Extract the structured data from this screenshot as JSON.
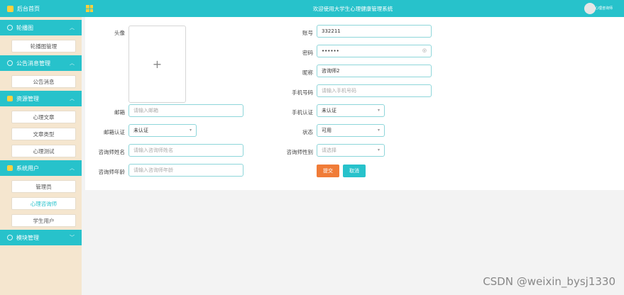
{
  "sidebar": {
    "home": "后台首页",
    "groups": [
      {
        "label": "轮播图",
        "items": [
          "轮播图管理"
        ]
      },
      {
        "label": "公告消息管理",
        "items": [
          "公告消息"
        ]
      },
      {
        "label": "资源管理",
        "items": [
          "心理文章",
          "文章类型",
          "心理测试"
        ]
      },
      {
        "label": "系统用户",
        "items": [
          "管理员",
          "心理咨询师",
          "学生用户"
        ]
      },
      {
        "label": "模块管理",
        "items": []
      }
    ]
  },
  "header": {
    "title": "欢迎使用大学生心理健康管理系统",
    "user": "心理咨询师"
  },
  "form": {
    "avatar_label": "头像",
    "avatar_plus": "+",
    "account_label": "账号",
    "account_value": "332211",
    "password_label": "密码",
    "password_value": "••••••",
    "nickname_label": "昵称",
    "nickname_value": "咨询师2",
    "phone_label": "手机号码",
    "phone_placeholder": "请输入手机号码",
    "email_label": "邮箱",
    "email_placeholder": "请输入邮箱",
    "phone_auth_label": "手机认证",
    "phone_auth_value": "未认证",
    "email_auth_label": "邮箱认证",
    "email_auth_value": "未认证",
    "status_label": "状态",
    "status_value": "可用",
    "counselor_name_label": "咨询师姓名",
    "counselor_name_placeholder": "请输入咨询师姓名",
    "counselor_gender_label": "咨询师性别",
    "counselor_gender_placeholder": "请选择",
    "counselor_age_label": "咨询师年龄",
    "counselor_age_placeholder": "请输入咨询师年龄",
    "submit_label": "提交",
    "cancel_label": "取消"
  },
  "watermark": "CSDN @weixin_bysj1330",
  "colors": {
    "accent": "#27c2cb",
    "submit": "#f07c38",
    "sidebar_bg": "#f5e6cf"
  }
}
